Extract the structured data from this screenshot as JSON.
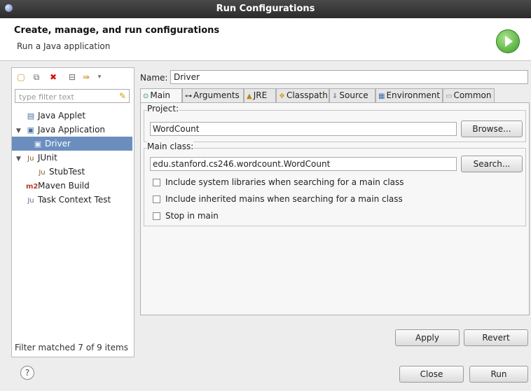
{
  "window": {
    "title": "Run Configurations"
  },
  "header": {
    "title": "Create, manage, and run configurations",
    "subtitle": "Run a Java application",
    "icon": "run-icon"
  },
  "toolbar": {
    "icons": [
      "new-configuration-icon",
      "duplicate-icon",
      "delete-icon",
      "collapse-all-icon",
      "filter-icon",
      "dropdown-icon"
    ]
  },
  "filter": {
    "placeholder": "type filter text"
  },
  "tree": {
    "items": [
      {
        "label": "Java Applet",
        "icon": "java-applet-icon"
      },
      {
        "label": "Java Application",
        "icon": "java-application-icon",
        "expanded": true
      },
      {
        "label": "Driver",
        "icon": "java-class-icon",
        "selected": true
      },
      {
        "label": "JUnit",
        "icon": "junit-icon",
        "expanded": true
      },
      {
        "label": "StubTest",
        "icon": "junit-icon"
      },
      {
        "label": "Maven Build",
        "icon": "maven-icon"
      },
      {
        "label": "Task Context Test",
        "icon": "task-context-icon"
      }
    ]
  },
  "status": {
    "text": "Filter matched 7 of 9 items"
  },
  "form": {
    "name_label": "Name:",
    "name_value": "Driver"
  },
  "tabs": [
    {
      "label": "Main",
      "icon": "main-tab-icon",
      "active": true
    },
    {
      "label": "Arguments",
      "icon": "arguments-icon"
    },
    {
      "label": "JRE",
      "icon": "jre-icon"
    },
    {
      "label": "Classpath",
      "icon": "classpath-icon"
    },
    {
      "label": "Source",
      "icon": "source-icon"
    },
    {
      "label": "Environment",
      "icon": "environment-icon"
    },
    {
      "label": "Common",
      "icon": "common-icon"
    }
  ],
  "main": {
    "project_label": "Project:",
    "project_value": "WordCount",
    "browse_label": "Browse...",
    "mainclass_label": "Main class:",
    "mainclass_value": "edu.stanford.cs246.wordcount.WordCount",
    "search_label": "Search...",
    "checkboxes": [
      {
        "label": "Include system libraries when searching for a main class",
        "checked": false
      },
      {
        "label": "Include inherited mains when searching for a main class",
        "checked": false
      },
      {
        "label": "Stop in main",
        "checked": false
      }
    ]
  },
  "buttons": {
    "apply": "Apply",
    "revert": "Revert",
    "close": "Close",
    "run": "Run",
    "help": "?"
  }
}
